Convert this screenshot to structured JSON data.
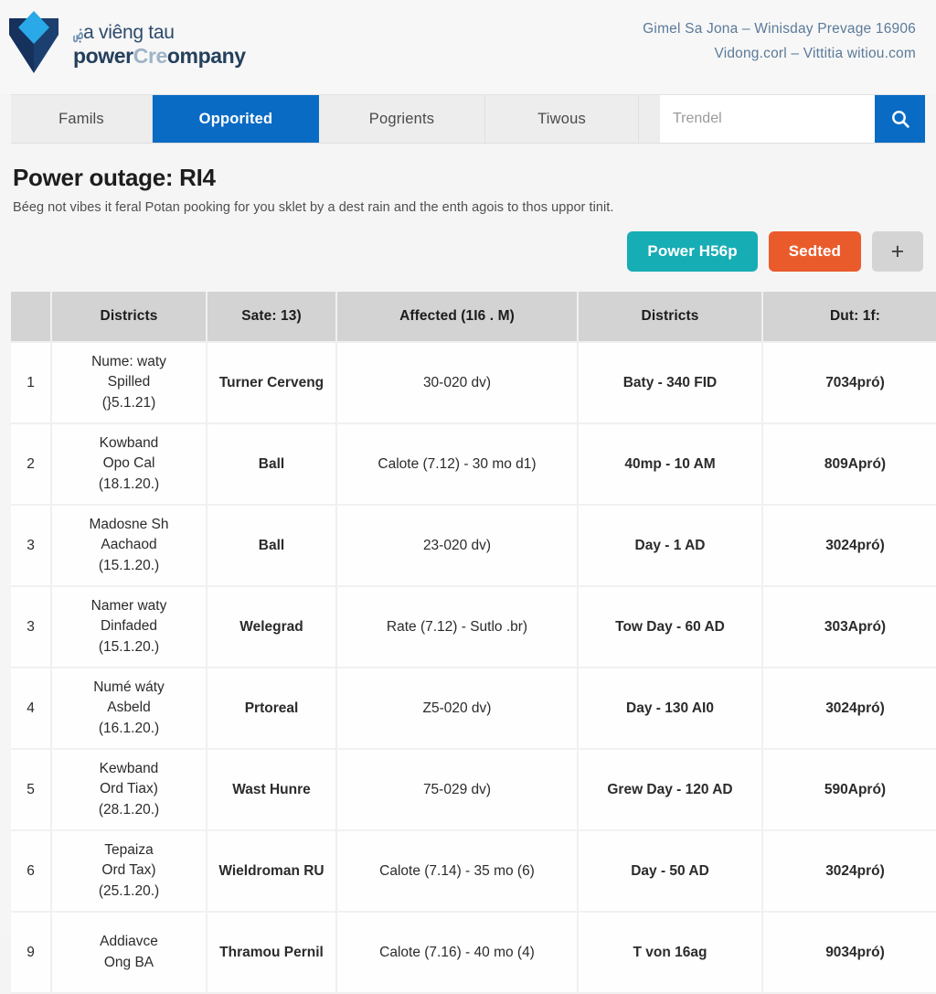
{
  "brand": {
    "line1_scribble": "ۻ",
    "line1": "a viêng tau",
    "line2_a": "power",
    "line2_dim": "Cre",
    "line2_b": "ompany"
  },
  "contact": {
    "line1": "Gimel Sa Jona  –  Winisday Prevage 16906",
    "line2": "Vidong.corl –  Vittitia witiou.com"
  },
  "nav": {
    "items": [
      {
        "label": "Famils",
        "active": false
      },
      {
        "label": "Opporited",
        "active": true
      },
      {
        "label": "Pogrients",
        "active": false
      },
      {
        "label": "Tiwous",
        "active": false
      }
    ],
    "search_placeholder": "Trendel",
    "search_value": ""
  },
  "page": {
    "title": "Power outage: RI4",
    "description": "Béeg not vibes it feral Potan pooking for you sklet by a dest rain and the enth agois to thos uppor tinit."
  },
  "actions": {
    "primary": "Power H56p",
    "secondary": "Sedted",
    "add": "+"
  },
  "colors": {
    "accent_blue": "#0a6bc4",
    "teal": "#17adb5",
    "orange": "#ea5b2c",
    "header_grey": "#d3d3d3",
    "link_blue": "#3c6896"
  },
  "table": {
    "headers": [
      "",
      "Districts",
      "Sate: 13)",
      "Affected (1I6 . M)",
      "Districts",
      "Dut: 1f:"
    ],
    "rows": [
      {
        "idx": "1",
        "name_l1": "Nume: waty",
        "name_l2": "Spilled",
        "name_l3": "(}5.1.21)",
        "sate": "Turner Cerveng",
        "affected": "30-020 dv)",
        "district": "Baty - 340 FID",
        "dut": "7034pró)"
      },
      {
        "idx": "2",
        "name_l1": "Kowband",
        "name_l2": "Opo Cal",
        "name_l3": "(18.1.20.)",
        "sate": "Ball",
        "affected": "Calote (7.12) - 30 mo d1)",
        "district": "40mp - 10 AM",
        "dut": "809Apró)"
      },
      {
        "idx": "3",
        "name_l1": "Madosne Sh",
        "name_l2": "Aachaod",
        "name_l3": "(15.1.20.)",
        "sate": "Ball",
        "affected": "23-020 dv)",
        "district": "Day - 1 AD",
        "dut": "3024pró)"
      },
      {
        "idx": "3",
        "name_l1": "Namer waty",
        "name_l2": "Dinfaded",
        "name_l3": "(15.1.20.)",
        "sate": "Welegrad",
        "affected": "Rate (7.12) - Sutlo .br)",
        "district": "Tow Day - 60 AD",
        "dut": "303Apró)"
      },
      {
        "idx": "4",
        "name_l1": "Numé wáty",
        "name_l2": "Asbeld",
        "name_l3": "(16.1.20.)",
        "sate": "Prtoreal",
        "affected": "Z5-020 dv)",
        "district": "Day - 130 AI0",
        "dut": "3024pró)"
      },
      {
        "idx": "5",
        "name_l1": "Kewband",
        "name_l2": "Ord Tiax)",
        "name_l3": "(28.1.20.)",
        "sate": "Wast Hunre",
        "affected": "75-029 dv)",
        "district": "Grew Day - 120 AD",
        "dut": "590Apró)"
      },
      {
        "idx": "6",
        "name_l1": "Tepaiza",
        "name_l2": "Ord Tax)",
        "name_l3": "(25.1.20.)",
        "sate": "Wieldroman RU",
        "affected": "Calote (7.14) - 35 mo (6)",
        "district": "Day - 50 AD",
        "dut": "3024pró)"
      },
      {
        "idx": "9",
        "name_l1": "Addiavce",
        "name_l2": "Ong BA",
        "name_l3": "",
        "sate": "Thramou Pernil",
        "affected": "Calote (7.16) - 40 mo (4)",
        "district": "T von 16ag",
        "dut": "9034pró)"
      }
    ]
  }
}
